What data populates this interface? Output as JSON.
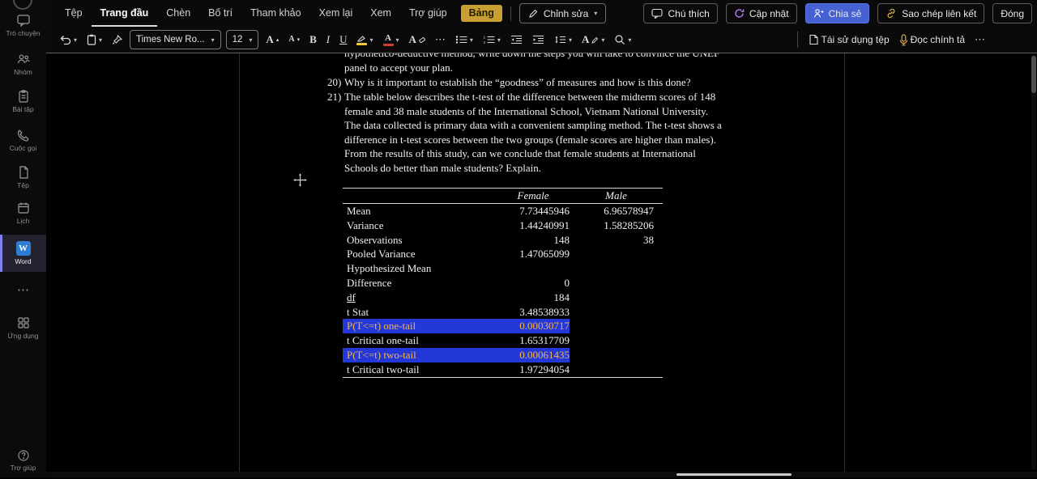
{
  "sidebar": {
    "items": [
      {
        "label": "Trò chuyện"
      },
      {
        "label": "Nhóm"
      },
      {
        "label": "Bài tập"
      },
      {
        "label": "Cuộc gọi"
      },
      {
        "label": "Tệp"
      },
      {
        "label": "Lịch"
      },
      {
        "label": "Word"
      },
      {
        "label": "⋯"
      },
      {
        "label": "Ứng dụng"
      },
      {
        "label": "Trợ giúp"
      }
    ]
  },
  "ribbon": {
    "tabs": [
      {
        "label": "Tệp"
      },
      {
        "label": "Trang đầu"
      },
      {
        "label": "Chèn"
      },
      {
        "label": "Bố trí"
      },
      {
        "label": "Tham khảo"
      },
      {
        "label": "Xem lại"
      },
      {
        "label": "Xem"
      },
      {
        "label": "Trợ giúp"
      },
      {
        "label": "Bảng"
      }
    ],
    "active_tab": "Trang đầu",
    "edit_mode": "Chỉnh sửa",
    "actions": {
      "comments": "Chú thích",
      "update": "Cập nhật",
      "share": "Chia sẻ",
      "copy_link": "Sao chép liên kết",
      "close": "Đóng"
    }
  },
  "toolbar": {
    "font_name": "Times New Ro...",
    "font_size": "12",
    "bold": "B",
    "italic": "I",
    "underline": "U",
    "letter_a": "A",
    "more": "⋯",
    "reuse_files": "Tái sử dụng tệp",
    "dictate": "Đọc chính tả"
  },
  "icons": {
    "chevron": "▾",
    "more": "⋯"
  },
  "document": {
    "clipped_lines": [
      "hypothetico-deductive method, write down the steps you will take to convince the UNEF",
      "panel to accept your plan."
    ],
    "q20": {
      "num": "20)",
      "text": "Why is it important to establish the “goodness” of measures and how is this done?"
    },
    "q21": {
      "num": "21)",
      "lines": [
        "The table below describes the t-test of the difference between the midterm scores of 148",
        "female and 38 male students of the International School, Vietnam National University.",
        "The data collected is primary data with a convenient sampling method. The t-test shows a",
        "difference in t-test scores between the two groups (female scores are higher than males).",
        "From the results of this study, can we conclude that female students at International",
        "Schools do better than male students? Explain."
      ]
    },
    "table": {
      "headers": {
        "female": "Female",
        "male": "Male"
      },
      "rows": [
        {
          "label": "Mean",
          "female": "7.73445946",
          "male": "6.96578947"
        },
        {
          "label": "Variance",
          "female": "1.44240991",
          "male": "1.58285206"
        },
        {
          "label": "Observations",
          "female": "148",
          "male": "38"
        },
        {
          "label": "Pooled Variance",
          "female": "1.47065099",
          "male": ""
        },
        {
          "label": "Hypothesized Mean",
          "female": "",
          "male": ""
        },
        {
          "label": "Difference",
          "female": "0",
          "male": ""
        },
        {
          "label": "df",
          "female": "184",
          "male": ""
        },
        {
          "label": "t Stat",
          "female": "3.48538933",
          "male": ""
        },
        {
          "label": "P(T<=t) one-tail",
          "female": "0.00030717",
          "male": ""
        },
        {
          "label": "t Critical one-tail",
          "female": "1.65317709",
          "male": ""
        },
        {
          "label": "P(T<=t) two-tail",
          "female": "0.00061435",
          "male": ""
        },
        {
          "label": "t Critical two-tail",
          "female": "1.97294054",
          "male": ""
        }
      ]
    }
  },
  "colors": {
    "selection_bg": "#2438d8",
    "selection_text": "#f2b64e",
    "share_button": "#4661d1",
    "contextual_tab_bg": "#c79f33",
    "highlight_yellow": "#f6c83c",
    "font_color_red": "#d23b2e",
    "word_blue": "#2d7dd2"
  }
}
